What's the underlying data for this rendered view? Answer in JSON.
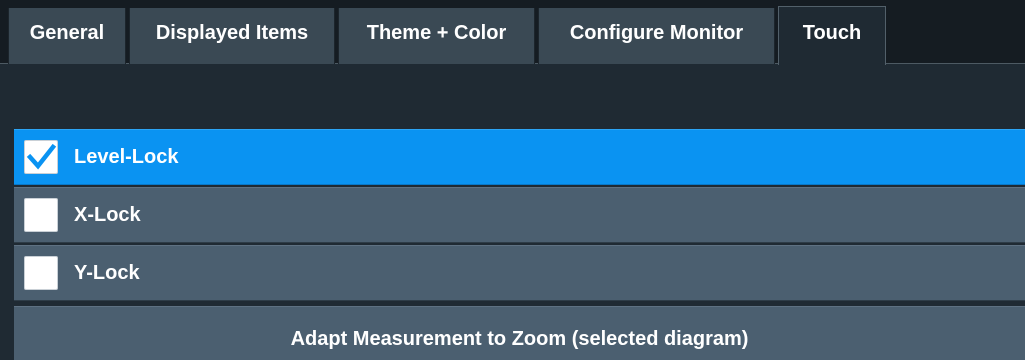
{
  "tabs": [
    {
      "label": "General"
    },
    {
      "label": "Displayed Items"
    },
    {
      "label": "Theme + Color"
    },
    {
      "label": "Configure Monitor"
    },
    {
      "label": "Touch",
      "active": true
    }
  ],
  "options": [
    {
      "label": "Level-Lock",
      "checked": true
    },
    {
      "label": "X-Lock",
      "checked": false
    },
    {
      "label": "Y-Lock",
      "checked": false
    }
  ],
  "adapt_button": {
    "label": "Adapt Measurement to Zoom (selected diagram)"
  },
  "colors": {
    "accent_blue": "#0a93f2",
    "row_gray": "#4b5f70",
    "background": "#1f2a33",
    "tab_inactive": "#3a4954"
  },
  "icons": {
    "checkmark": "check-icon"
  }
}
